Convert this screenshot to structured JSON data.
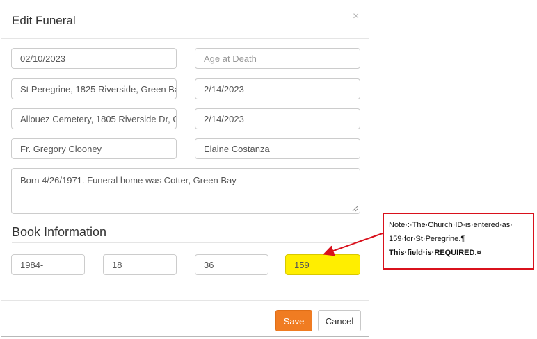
{
  "modal": {
    "title": "Edit Funeral",
    "close_glyph": "×",
    "fields": {
      "date_of_death": "02/10/2023",
      "age_at_death_placeholder": "Age at Death",
      "church": "St Peregrine, 1825 Riverside, Green Ba",
      "church_date": "2/14/2023",
      "cemetery": "Allouez Cemetery, 1805 Riverside Dr, G",
      "burial_date": "2/14/2023",
      "celebrant": "Fr. Gregory Clooney",
      "contact": "Elaine Costanza",
      "notes": "Born 4/26/1971. Funeral home was Cotter, Green Bay"
    },
    "book_section_title": "Book Information",
    "book_fields": {
      "book": "1984-",
      "page": "18",
      "entry": "36",
      "church_id": "159"
    },
    "footer": {
      "save_label": "Save",
      "cancel_label": "Cancel"
    }
  },
  "annotation": {
    "line1": "Note·:·The·Church·ID·is·entered·as·",
    "line2": "159·for·St·Peregrine.¶",
    "line3": "This·field·is·REQUIRED.¤",
    "border_color": "#d9111c",
    "arrow_color": "#d9111c"
  },
  "colors": {
    "save_button": "#f07c22",
    "highlight": "#ffee00"
  },
  "icons": {
    "close": "close-icon",
    "resize": "resize-grip-icon",
    "arrow": "arrow-icon"
  }
}
